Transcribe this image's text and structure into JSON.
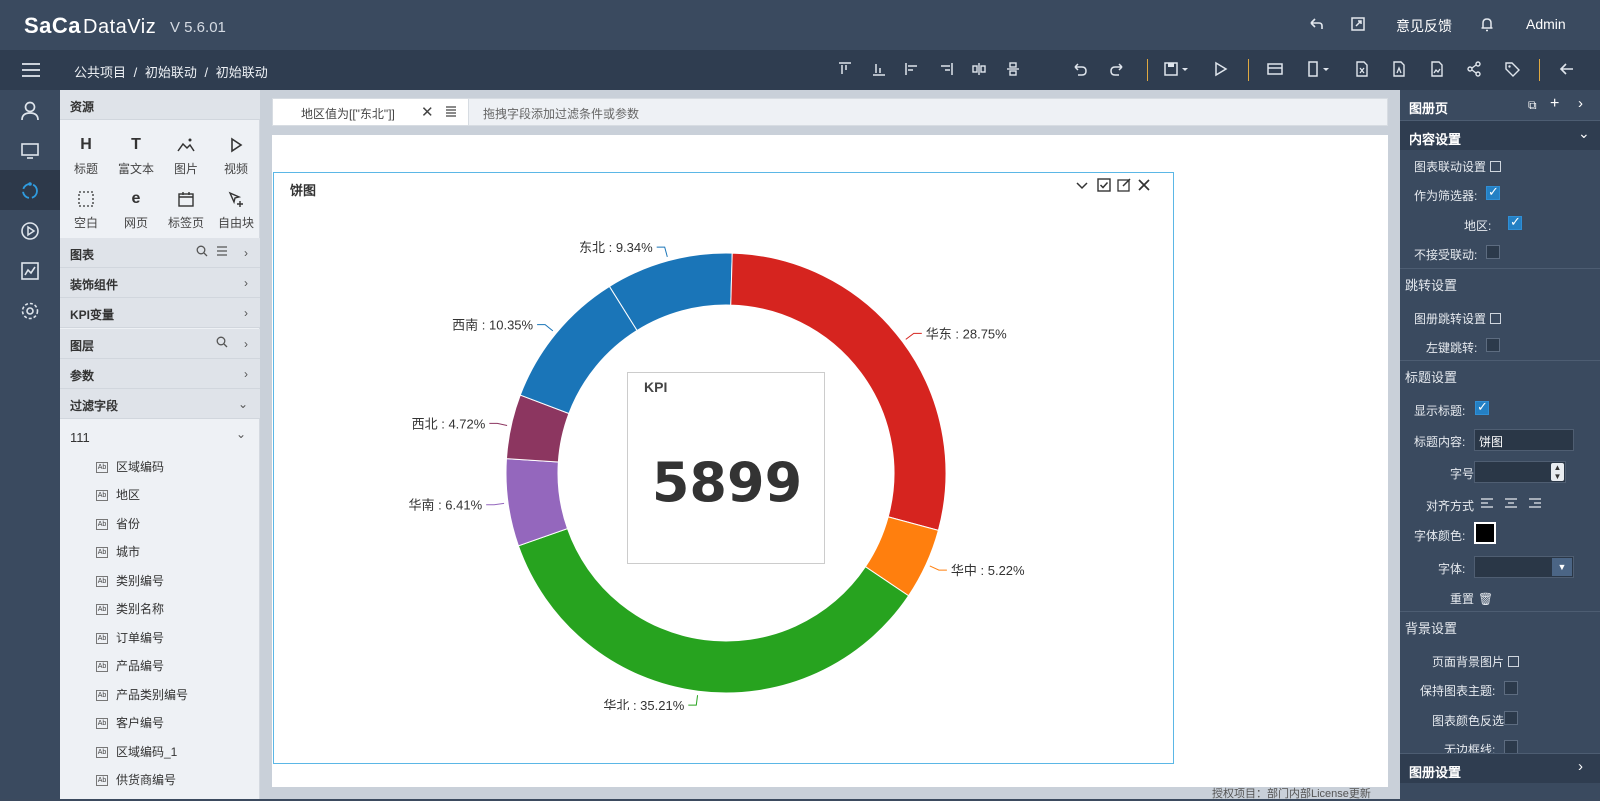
{
  "header": {
    "brand": "SaCa",
    "brand_suffix": "DataViz",
    "version": "V 5.6.01",
    "feedback_label": "意见反馈",
    "user_label": "Admin"
  },
  "breadcrumb": [
    "公共项目",
    "/",
    "初始联动",
    "/",
    "初始联动"
  ],
  "resources": {
    "title": "资源",
    "items": [
      {
        "glyph": "H",
        "label": "标题"
      },
      {
        "glyph": "T",
        "label": "富文本"
      },
      {
        "glyph": "",
        "label": "图片"
      },
      {
        "glyph": "",
        "label": "视频"
      },
      {
        "glyph": "",
        "label": "空白"
      },
      {
        "glyph": "e",
        "label": "网页"
      },
      {
        "glyph": "",
        "label": "标签页"
      },
      {
        "glyph": "",
        "label": "自由块"
      }
    ],
    "sections": [
      "图表",
      "装饰组件",
      "KPI变量",
      "图层",
      "参数",
      "过滤字段"
    ],
    "field_group": "111",
    "fields": [
      "区域编码",
      "地区",
      "省份",
      "城市",
      "类别编号",
      "类别名称",
      "订单编号",
      "产品编号",
      "产品类别编号",
      "客户编号",
      "区域编码_1",
      "供货商编号"
    ]
  },
  "filterbar": {
    "chip_label": "地区值为[[\"东北\"]]",
    "hint": "拖拽字段添加过滤条件或参数"
  },
  "widget": {
    "title": "饼图",
    "kpi_label": "KPI",
    "kpi_value": "5899"
  },
  "chart_data": {
    "type": "pie",
    "donut": true,
    "categories": [
      "东北",
      "华东",
      "华中",
      "华北",
      "华南",
      "西北",
      "西南"
    ],
    "values": [
      9.34,
      28.75,
      5.22,
      35.21,
      6.41,
      4.72,
      10.35
    ],
    "labels": [
      "东北 : 9.34%",
      "华东 : 28.75%",
      "华中 : 5.22%",
      "华北 : 35.21%",
      "华南 : 6.41%",
      "西北 : 4.72%",
      "西南 : 10.35%"
    ],
    "colors": [
      "#1a75b8",
      "#d6241f",
      "#ff7f0e",
      "#27a31f",
      "#9467bd",
      "#8c3660",
      "#1a75b8"
    ]
  },
  "right_panel": {
    "title": "图册页",
    "content_settings": "内容设置",
    "chart_link_settings": "图表联动设置",
    "as_filter": "作为筛选器:",
    "region": "地区:",
    "no_linkage": "不接受联动:",
    "jump_settings": "跳转设置",
    "album_jump": "图册跳转设置",
    "left_click_jump": "左键跳转:",
    "title_settings": "标题设置",
    "show_title": "显示标题:",
    "title_content": "标题内容:",
    "title_value": "饼图",
    "font_size": "字号",
    "align": "对齐方式",
    "font_color": "字体颜色:",
    "font_family": "字体:",
    "reset": "重置",
    "bg_settings": "背景设置",
    "page_bg": "页面背景图片",
    "keep_theme": "保持图表主题:",
    "invert_color": "图表颜色反选",
    "no_border": "无边框线:",
    "album_settings": "图册设置"
  },
  "footer": {
    "license_note": "授权项目：部门内部License更新"
  }
}
